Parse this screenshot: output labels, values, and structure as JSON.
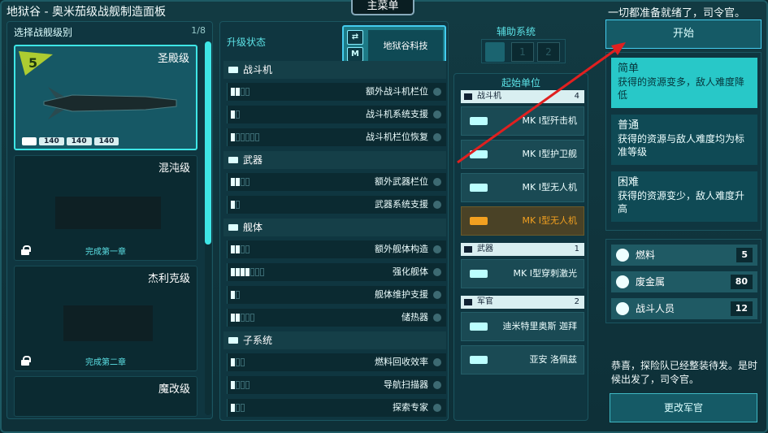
{
  "window": {
    "title": "地狱谷 - 奥米茄级战舰制造面板",
    "main_menu": "主菜单",
    "ready_text": "一切都准备就绪了，司令官。"
  },
  "ships": {
    "header": "选择战舰级别",
    "count": "1/8",
    "selected_badge": "5",
    "items": [
      {
        "name": "圣殿级",
        "stats": [
          "140",
          "140",
          "140"
        ],
        "locked": false
      },
      {
        "name": "混沌级",
        "unlock": "完成第一章",
        "locked": true
      },
      {
        "name": "杰利克级",
        "unlock": "完成第二章",
        "locked": true
      },
      {
        "name": "魔改级"
      }
    ]
  },
  "upgrades": {
    "title": "升级状态",
    "tech_label": "地狱谷科技",
    "categories": [
      {
        "label": "战斗机",
        "rows": [
          {
            "label": "额外战斗机栏位",
            "on": 2,
            "total": 4
          },
          {
            "label": "战斗机系统支援",
            "on": 1,
            "total": 2
          },
          {
            "label": "战斗机栏位恢复",
            "on": 1,
            "total": 6
          }
        ]
      },
      {
        "label": "武器",
        "rows": [
          {
            "label": "额外武器栏位",
            "on": 2,
            "total": 4
          },
          {
            "label": "武器系统支援",
            "on": 1,
            "total": 2
          }
        ]
      },
      {
        "label": "舰体",
        "rows": [
          {
            "label": "额外舰体构造",
            "on": 2,
            "total": 4
          },
          {
            "label": "强化舰体",
            "on": 4,
            "total": 7
          },
          {
            "label": "舰体维护支援",
            "on": 1,
            "total": 2
          },
          {
            "label": "储热器",
            "on": 2,
            "total": 5
          }
        ]
      },
      {
        "label": "子系统",
        "rows": [
          {
            "label": "燃料回收效率",
            "on": 1,
            "total": 3
          },
          {
            "label": "导航扫描器",
            "on": 1,
            "total": 4
          },
          {
            "label": "探索专家",
            "on": 1,
            "total": 3
          }
        ]
      }
    ]
  },
  "aux": {
    "title": "辅助系统",
    "slots": [
      "1",
      "2"
    ]
  },
  "units": {
    "title": "起始单位",
    "groups": [
      {
        "label": "战斗机",
        "count": "4",
        "items": [
          "MK I型歼击机",
          "MK I型护卫舰",
          "MK I型无人机",
          "MK I型无人机"
        ]
      },
      {
        "label": "武器",
        "count": "1",
        "items": [
          "MK I型穿刺激光"
        ]
      },
      {
        "label": "军官",
        "count": "2",
        "items": [
          "迪米特里奥斯 迦拜",
          "亚安 洛佩兹"
        ]
      }
    ]
  },
  "right": {
    "start": "开始",
    "difficulties": [
      {
        "name": "简单",
        "desc": "获得的资源变多，敌人难度降低"
      },
      {
        "name": "普通",
        "desc": "获得的资源与敌人难度均为标准等级"
      },
      {
        "name": "困难",
        "desc": "获得的资源变少，敌人难度升高"
      }
    ],
    "resources": [
      {
        "name": "燃料",
        "value": "5"
      },
      {
        "name": "废金属",
        "value": "80"
      },
      {
        "name": "战斗人员",
        "value": "12"
      }
    ],
    "message": "恭喜，探险队已经整装待发。是时候出发了，司令官。",
    "change_officer": "更改军官"
  },
  "colors": {
    "accent": "#3ee6e6",
    "panel": "#0f3640",
    "highlight_orange": "#f2a020",
    "annotation": "#e02020"
  }
}
